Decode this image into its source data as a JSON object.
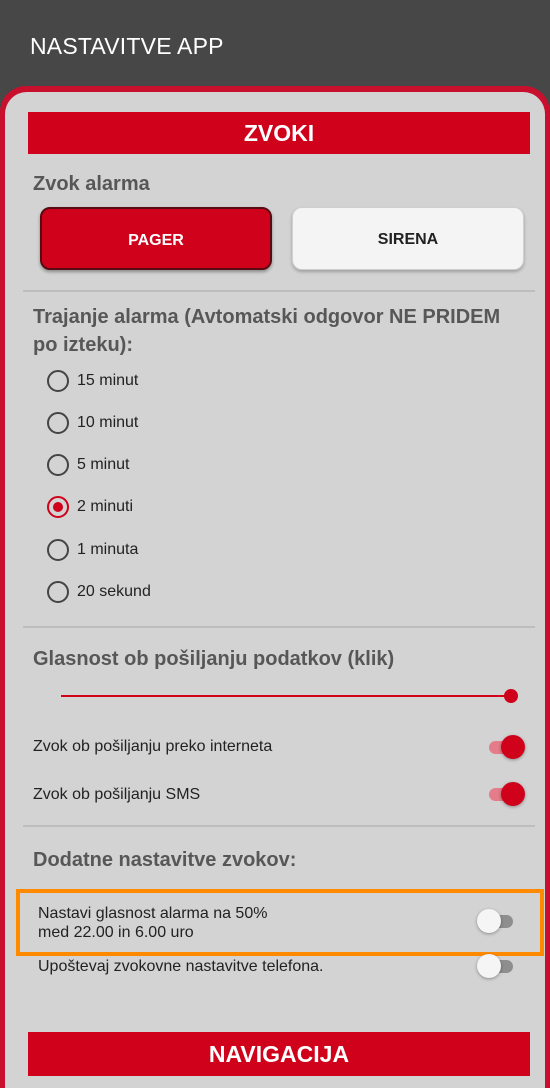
{
  "appbar": {
    "title": "NASTAVITVE APP"
  },
  "sections": {
    "sounds_title": "ZVOKI",
    "navigation_title": "NAVIGACIJA"
  },
  "alarm_sound": {
    "heading": "Zvok alarma",
    "pager_label": "PAGER",
    "sirena_label": "SIRENA",
    "selected": "PAGER"
  },
  "duration": {
    "heading": "Trajanje alarma (Avtomatski odgovor NE PRIDEM po izteku):",
    "options": [
      "15 minut",
      "10 minut",
      "5 minut",
      "2 minuti",
      "1 minuta",
      "20 sekund"
    ],
    "selected": "2 minuti"
  },
  "volume": {
    "heading": "Glasnost ob pošiljanju podatkov (klik)",
    "level": 1.0,
    "internet_label": "Zvok ob pošiljanju preko interneta",
    "internet_on": true,
    "sms_label": "Zvok ob pošiljanju SMS",
    "sms_on": true
  },
  "extra": {
    "heading": "Dodatne nastavitve zvokov:",
    "night_volume_line1": "Nastavi glasnost alarma na 50%",
    "night_volume_line2": "med 22.00 in 6.00 uro",
    "night_volume_on": false,
    "phone_settings_label": "Upoštevaj zvokovne nastavitve telefona.",
    "phone_settings_on": false
  },
  "colors": {
    "accent": "#d0021b",
    "highlight": "#ff8a00",
    "appbar": "#474747",
    "panel": "#d3d3d3"
  }
}
